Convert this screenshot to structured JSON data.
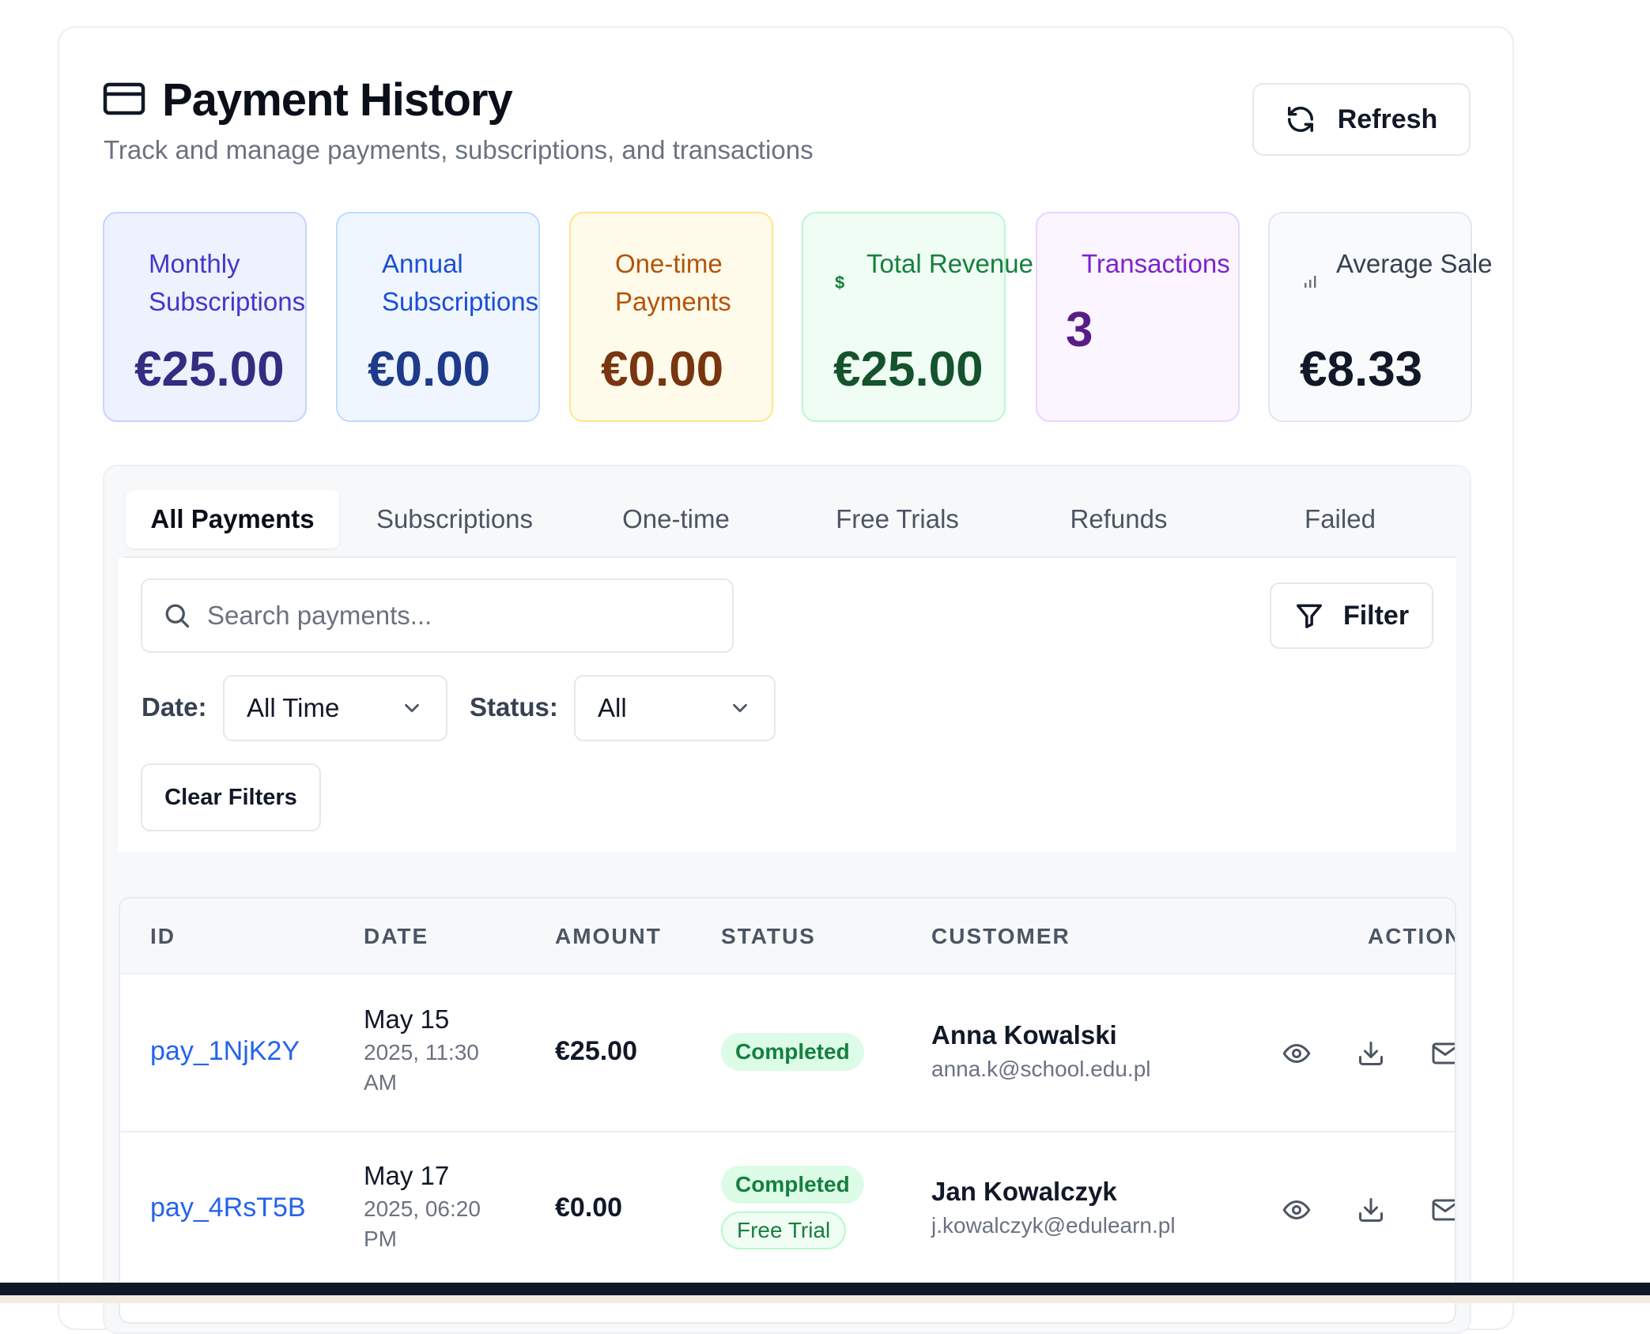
{
  "header": {
    "title": "Payment History",
    "subtitle": "Track and manage payments, subscriptions, and transactions",
    "refresh_label": "Refresh"
  },
  "stats": [
    {
      "label": "Monthly Subscriptions",
      "value": "€25.00",
      "bg": "#eef2ff",
      "border": "#c7d2fe",
      "label_color": "#4338ca",
      "value_color": "#312e81"
    },
    {
      "label": "Annual Subscriptions",
      "value": "€0.00",
      "bg": "#eff6ff",
      "border": "#bfdbfe",
      "label_color": "#1d4ed8",
      "value_color": "#1e3a8a"
    },
    {
      "label": "One-time Payments",
      "value": "€0.00",
      "bg": "#fffbeb",
      "border": "#fde68a",
      "label_color": "#b45309",
      "value_color": "#78350f"
    },
    {
      "label": "Total Revenue",
      "value": "€25.00",
      "icon": "$",
      "bg": "#f0fdf4",
      "border": "#bbf7d0",
      "label_color": "#15803d",
      "value_color": "#14532d"
    },
    {
      "label": "Transactions",
      "value": "3",
      "bg": "#faf5ff",
      "border": "#e9d5ff",
      "label_color": "#7e22ce",
      "value_color": "#581c87"
    },
    {
      "label": "Average Sale",
      "value": "€8.33",
      "bg": "#f8fafc",
      "border": "#e2e8f0",
      "label_color": "#374151",
      "value_color": "#111827"
    }
  ],
  "tabs": [
    "All Payments",
    "Subscriptions",
    "One-time",
    "Free Trials",
    "Refunds",
    "Failed"
  ],
  "filters": {
    "search_placeholder": "Search payments...",
    "filter_label": "Filter",
    "date_label": "Date:",
    "date_value": "All Time",
    "status_label": "Status:",
    "status_value": "All",
    "clear_label": "Clear Filters"
  },
  "table": {
    "columns": [
      "ID",
      "DATE",
      "AMOUNT",
      "STATUS",
      "CUSTOMER",
      "ACTIONS"
    ],
    "rows": [
      {
        "id": "pay_1NjK2Y",
        "date": "May 15",
        "date_rest": "2025, 11:30 AM",
        "amount": "€25.00",
        "badges": [
          "Completed"
        ],
        "customer": "Anna Kowalski",
        "email": "anna.k@school.edu.pl"
      },
      {
        "id": "pay_4RsT5B",
        "date": "May 17",
        "date_rest": "2025, 06:20 PM",
        "amount": "€0.00",
        "badges": [
          "Completed",
          "Free Trial"
        ],
        "customer": "Jan Kowalczyk",
        "email": "j.kowalczyk@edulearn.pl"
      }
    ]
  },
  "icons": {
    "header": "credit-card-icon",
    "refresh": "refresh-icon",
    "search": "search-icon",
    "filter": "filter-icon",
    "select": "chevron-down-icon",
    "actions": [
      "eye-icon",
      "download-icon",
      "mail-icon"
    ]
  }
}
